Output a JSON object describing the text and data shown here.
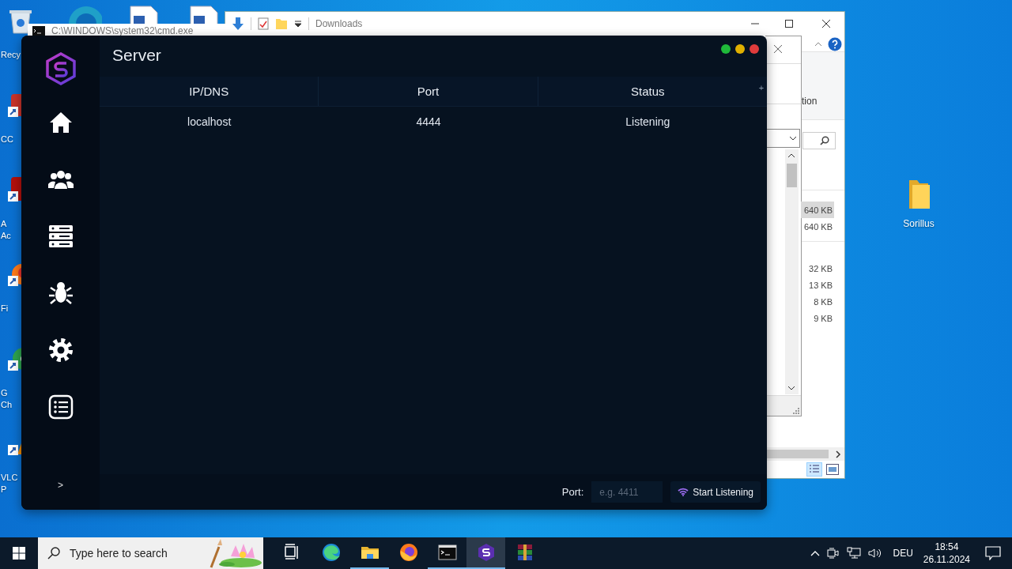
{
  "desktop": {
    "left_icons": [
      {
        "kind": "recycle",
        "lines": [
          "Recy"
        ]
      },
      {
        "kind": "shortcut-red",
        "lines": [
          "CC"
        ]
      },
      {
        "kind": "shortcut-darkred",
        "lines": [
          "A",
          "Ac"
        ]
      },
      {
        "kind": "firefox",
        "lines": [
          "Fi"
        ]
      },
      {
        "kind": "chrome",
        "lines": [
          "G",
          "Ch"
        ]
      },
      {
        "kind": "vlc",
        "lines": [
          "VLC",
          "P"
        ]
      }
    ],
    "top_icons": [
      {
        "kind": "edge"
      },
      {
        "kind": "document"
      },
      {
        "kind": "document"
      }
    ],
    "right_icons": [
      {
        "kind": "folder",
        "label": "Sorillus"
      }
    ]
  },
  "explorer": {
    "title": "Downloads",
    "ribbon_text": "tion",
    "sizes": [
      {
        "text": "640 KB",
        "selected": true
      },
      {
        "text": "640 KB",
        "selected": false
      },
      {
        "text": "32 KB",
        "selected": false
      },
      {
        "text": "13 KB",
        "selected": false
      },
      {
        "text": "8 KB",
        "selected": false
      },
      {
        "text": "9 KB",
        "selected": false
      }
    ]
  },
  "console": {
    "title": "C:\\WINDOWS\\system32\\cmd.exe"
  },
  "app": {
    "title": "Server",
    "nav": [
      {
        "kind": "home"
      },
      {
        "kind": "users"
      },
      {
        "kind": "servers"
      },
      {
        "kind": "bug"
      },
      {
        "kind": "settings"
      },
      {
        "kind": "list"
      }
    ],
    "expand": ">",
    "table": {
      "columns": [
        "IP/DNS",
        "Port",
        "Status"
      ],
      "add": "+",
      "rows": [
        [
          "localhost",
          "4444",
          "Listening"
        ]
      ]
    },
    "footer": {
      "port_label": "Port:",
      "port_field": {
        "placeholder": "e.g. 4411"
      },
      "button": "Start Listening"
    }
  },
  "taskbar": {
    "search_placeholder": "Type here to search",
    "apps": [
      {
        "kind": "taskview",
        "running": false,
        "selected": false
      },
      {
        "kind": "edge",
        "running": false,
        "selected": false
      },
      {
        "kind": "explorer",
        "running": true,
        "selected": false
      },
      {
        "kind": "firefox",
        "running": false,
        "selected": false
      },
      {
        "kind": "console",
        "running": true,
        "selected": false
      },
      {
        "kind": "sorillus",
        "running": true,
        "selected": true
      },
      {
        "kind": "archive",
        "running": false,
        "selected": false
      }
    ],
    "tray": {
      "language": "DEU",
      "time": "18:54",
      "date": "26.11.2024"
    }
  }
}
